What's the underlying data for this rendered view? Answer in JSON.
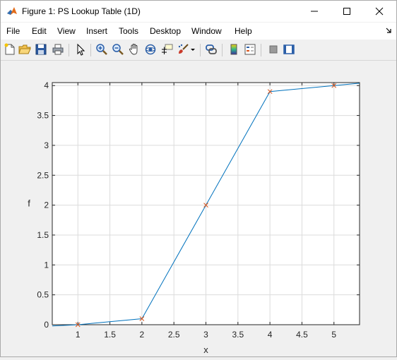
{
  "window": {
    "title": "Figure 1: PS Lookup Table (1D)",
    "controls": [
      "minimize",
      "maximize",
      "close"
    ]
  },
  "menubar": {
    "items": [
      "File",
      "Edit",
      "View",
      "Insert",
      "Tools",
      "Desktop",
      "Window",
      "Help"
    ]
  },
  "toolbar": {
    "icons": [
      "new-figure-icon",
      "open-file-icon",
      "save-icon",
      "print-icon",
      "pointer-icon",
      "zoom-in-icon",
      "zoom-out-icon",
      "pan-icon",
      "rotate-3d-icon",
      "data-cursor-icon",
      "brush-icon",
      "brush-dropdown-icon",
      "link-plot-icon",
      "colorbar-icon",
      "legend-icon",
      "hide-plot-tools-icon",
      "show-plot-tools-icon"
    ]
  },
  "colors": {
    "line": "#0072bd",
    "marker": "#d95319",
    "grid": "#dcdcdc",
    "axes_bg": "#ffffff",
    "figure_bg": "#f0f0f0"
  },
  "chart_data": {
    "type": "line",
    "xlabel": "x",
    "ylabel": "f",
    "xlim": [
      0.6,
      5.4
    ],
    "ylim": [
      0,
      4.05
    ],
    "xticks": [
      "1",
      "1.5",
      "2",
      "2.5",
      "3",
      "3.5",
      "4",
      "4.5",
      "5"
    ],
    "yticks": [
      "0",
      "0.5",
      "1",
      "1.5",
      "2",
      "2.5",
      "3",
      "3.5",
      "4"
    ],
    "grid": true,
    "series": [
      {
        "style": "line",
        "x": [
          0.6,
          1,
          2,
          3,
          4,
          5,
          5.4
        ],
        "y": [
          -0.02,
          0.0,
          0.1,
          2.0,
          3.9,
          4.0,
          4.04
        ]
      },
      {
        "style": "markers",
        "marker": "x",
        "x": [
          1,
          2,
          3,
          4,
          5
        ],
        "y": [
          0.0,
          0.1,
          2.0,
          3.9,
          4.0
        ]
      }
    ]
  }
}
